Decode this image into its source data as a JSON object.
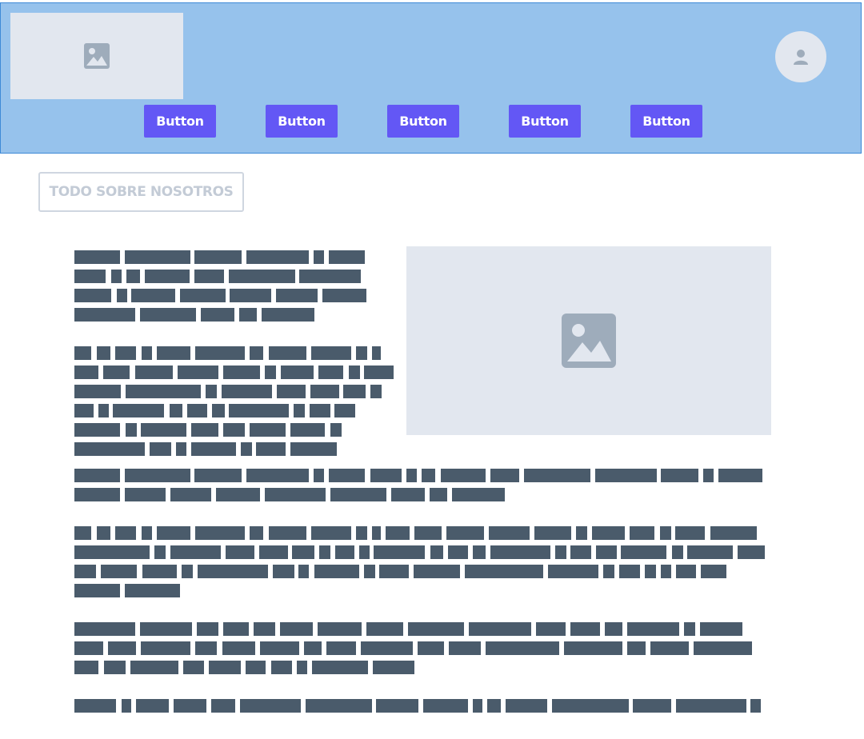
{
  "header": {
    "logo_icon": "image-icon",
    "avatar_icon": "user-icon",
    "nav_buttons": [
      "Button",
      "Button",
      "Button",
      "Button",
      "Button"
    ],
    "colors": {
      "header_bg": "#96c2ec",
      "button_bg": "#6357f5",
      "placeholder_bg": "#e2e7ef"
    }
  },
  "main": {
    "section_tag": "TODO SOBRE NOSOTROS",
    "hero_image_icon": "image-icon",
    "text_color": "#4a5b6b"
  }
}
